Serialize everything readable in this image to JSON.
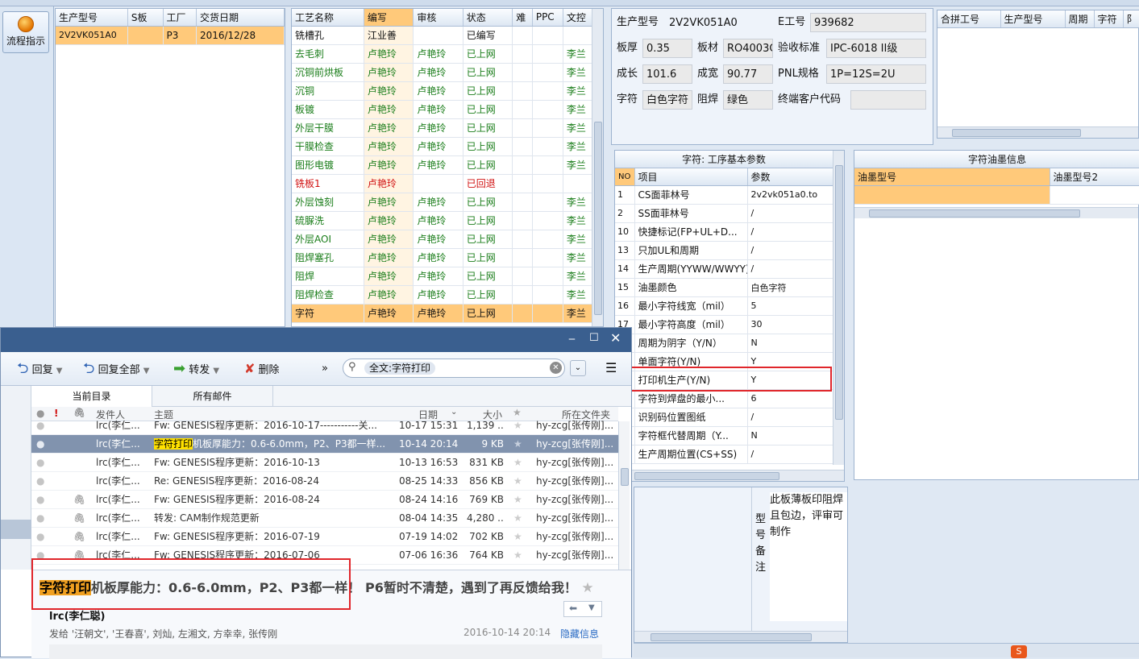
{
  "left_toolbar": {
    "flow_button": "流程指示"
  },
  "product_grid": {
    "headers": [
      "生产型号",
      "S板",
      "工厂",
      "交货日期"
    ],
    "rows": [
      [
        "2V2VK051A0",
        "",
        "P3",
        "2016/12/28"
      ]
    ]
  },
  "process_grid": {
    "headers": [
      "工艺名称",
      "编写",
      "审核",
      "状态",
      "难",
      "PPC",
      "文控"
    ],
    "rows": [
      {
        "name": "铣槽孔",
        "writer": "江业善",
        "reviewer": "",
        "status": "已编写",
        "doc": "",
        "style": "normal"
      },
      {
        "name": "去毛刺",
        "writer": "卢艳玲",
        "reviewer": "卢艳玲",
        "status": "已上网",
        "doc": "李兰",
        "style": "green"
      },
      {
        "name": "沉铜前烘板",
        "writer": "卢艳玲",
        "reviewer": "卢艳玲",
        "status": "已上网",
        "doc": "李兰",
        "style": "green"
      },
      {
        "name": "沉铜",
        "writer": "卢艳玲",
        "reviewer": "卢艳玲",
        "status": "已上网",
        "doc": "李兰",
        "style": "green"
      },
      {
        "name": "板镀",
        "writer": "卢艳玲",
        "reviewer": "卢艳玲",
        "status": "已上网",
        "doc": "李兰",
        "style": "green"
      },
      {
        "name": "外层干膜",
        "writer": "卢艳玲",
        "reviewer": "卢艳玲",
        "status": "已上网",
        "doc": "李兰",
        "style": "green"
      },
      {
        "name": "干膜检查",
        "writer": "卢艳玲",
        "reviewer": "卢艳玲",
        "status": "已上网",
        "doc": "李兰",
        "style": "green"
      },
      {
        "name": "图形电镀",
        "writer": "卢艳玲",
        "reviewer": "卢艳玲",
        "status": "已上网",
        "doc": "李兰",
        "style": "green"
      },
      {
        "name": "铣板1",
        "writer": "卢艳玲",
        "reviewer": "",
        "status": "已回退",
        "doc": "",
        "style": "red"
      },
      {
        "name": "外层蚀刻",
        "writer": "卢艳玲",
        "reviewer": "卢艳玲",
        "status": "已上网",
        "doc": "李兰",
        "style": "green"
      },
      {
        "name": "硫脲洗",
        "writer": "卢艳玲",
        "reviewer": "卢艳玲",
        "status": "已上网",
        "doc": "李兰",
        "style": "green"
      },
      {
        "name": "外层AOI",
        "writer": "卢艳玲",
        "reviewer": "卢艳玲",
        "status": "已上网",
        "doc": "李兰",
        "style": "green"
      },
      {
        "name": "阻焊塞孔",
        "writer": "卢艳玲",
        "reviewer": "卢艳玲",
        "status": "已上网",
        "doc": "李兰",
        "style": "green"
      },
      {
        "name": "阻焊",
        "writer": "卢艳玲",
        "reviewer": "卢艳玲",
        "status": "已上网",
        "doc": "李兰",
        "style": "green"
      },
      {
        "name": "阻焊检查",
        "writer": "卢艳玲",
        "reviewer": "卢艳玲",
        "status": "已上网",
        "doc": "李兰",
        "style": "green"
      },
      {
        "name": "字符",
        "writer": "卢艳玲",
        "reviewer": "卢艳玲",
        "status": "已上网",
        "doc": "李兰",
        "style": "selected"
      }
    ]
  },
  "info": {
    "part_no_label": "生产型号",
    "part_no": "2V2VK051A0",
    "e_no_label": "E工号",
    "e_no": "939682",
    "thickness_label": "板厚",
    "thickness": "0.35",
    "material_label": "板材",
    "material": "RO4003C",
    "standard_label": "验收标准",
    "standard": "IPC-6018 II级",
    "length_label": "成长",
    "length": "101.6",
    "width_label": "成宽",
    "width": "90.77",
    "pnl_label": "PNL规格",
    "pnl": "1P=12S=2U",
    "char_label": "字符",
    "char": "白色字符",
    "mask_label": "阻焊",
    "mask": "绿色",
    "customer_label": "终端客户代码",
    "customer": ""
  },
  "merge_grid": {
    "headers": [
      "合拼工号",
      "生产型号",
      "周期",
      "字符",
      "阝"
    ]
  },
  "param_grid": {
    "title": "字符: 工序基本参数",
    "headers": [
      "NO",
      "项目",
      "参数"
    ],
    "rows": [
      [
        "1",
        "CS面菲林号",
        "2v2vk051a0.to"
      ],
      [
        "2",
        "SS面菲林号",
        "/"
      ],
      [
        "10",
        "快捷标记(FP+UL+D...",
        "/"
      ],
      [
        "13",
        "只加UL和周期",
        "/"
      ],
      [
        "14",
        "生产周期(YYWW/WWYY)",
        "/"
      ],
      [
        "15",
        "油墨颜色",
        "白色字符"
      ],
      [
        "16",
        "最小字符线宽（mil）",
        "5"
      ],
      [
        "17",
        "最小字符高度（mil）",
        "30"
      ],
      [
        "",
        "周期为阴字（Y/N）",
        "N"
      ],
      [
        "",
        "单面字符(Y/N)",
        "Y"
      ],
      [
        "",
        "打印机生产(Y/N)",
        "Y"
      ],
      [
        "",
        "字符到焊盘的最小...",
        "6"
      ],
      [
        "",
        "识别码位置图纸",
        "/"
      ],
      [
        "",
        "字符框代替周期（Y...",
        "N"
      ],
      [
        "",
        "生产周期位置(CS+SS)",
        "/"
      ]
    ]
  },
  "ink_grid": {
    "title": "字符油墨信息",
    "headers": [
      "油墨型号",
      "油墨型号2"
    ]
  },
  "note": {
    "label_chars": [
      "型",
      "号",
      "备",
      "注"
    ],
    "text": "此板薄板印阻焊且包边，评审可制作"
  },
  "mail": {
    "toolbar": {
      "reply": "回复",
      "reply_all": "回复全部",
      "forward": "转发",
      "delete": "删除",
      "more": "»"
    },
    "search": "全文:字符打印",
    "tabs": [
      "当前目录",
      "所有邮件"
    ],
    "columns": {
      "sender": "发件人",
      "subject": "主题",
      "date": "日期",
      "size": "大小",
      "folder": "所在文件夹"
    },
    "rows": [
      {
        "sender": "lrc(李仁...",
        "subject": "Fw: GENESIS程序更新：2016-10-17-----------关...",
        "subject_hl": "",
        "date": "10-17 15:31",
        "size": "1,139 ...",
        "folder": "hy-zcg[张传刚]...",
        "attach": false,
        "selected": false
      },
      {
        "sender": "lrc(李仁...",
        "subject": "机板厚能力：0.6-6.0mm，P2、P3都一样...",
        "subject_hl": "字符打印",
        "date": "10-14 20:14",
        "size": "9 KB",
        "folder": "hy-zcg[张传刚]...",
        "attach": false,
        "selected": true
      },
      {
        "sender": "lrc(李仁...",
        "subject": "Fw: GENESIS程序更新：2016-10-13",
        "subject_hl": "",
        "date": "10-13 16:53",
        "size": "831 KB",
        "folder": "hy-zcg[张传刚]...",
        "attach": false,
        "selected": false
      },
      {
        "sender": "lrc(李仁...",
        "subject": "Re: GENESIS程序更新：2016-08-24",
        "subject_hl": "",
        "date": "08-25 14:33",
        "size": "856 KB",
        "folder": "hy-zcg[张传刚]...",
        "attach": false,
        "selected": false
      },
      {
        "sender": "lrc(李仁...",
        "subject": "Fw: GENESIS程序更新：2016-08-24",
        "subject_hl": "",
        "date": "08-24 14:16",
        "size": "769 KB",
        "folder": "hy-zcg[张传刚]...",
        "attach": true,
        "selected": false
      },
      {
        "sender": "lrc(李仁...",
        "subject": "转发: CAM制作规范更新",
        "subject_hl": "",
        "date": "08-04 14:35",
        "size": "4,280 ...",
        "folder": "hy-zcg[张传刚]...",
        "attach": true,
        "selected": false
      },
      {
        "sender": "lrc(李仁...",
        "subject": "Fw: GENESIS程序更新：2016-07-19",
        "subject_hl": "",
        "date": "07-19 14:02",
        "size": "702 KB",
        "folder": "hy-zcg[张传刚]...",
        "attach": true,
        "selected": false
      },
      {
        "sender": "lrc(李仁...",
        "subject": "Fw: GENESIS程序更新：2016-07-06",
        "subject_hl": "",
        "date": "07-06 16:36",
        "size": "764 KB",
        "folder": "hy-zcg[张传刚]...",
        "attach": true,
        "selected": false
      }
    ],
    "preview": {
      "subject_hl": "字符打印",
      "subject_rest": "机板厚能力：0.6-6.0mm，P2、P3都一样！ P6暂时不清楚，遇到了再反馈给我！",
      "from": "lrc(李仁聪)",
      "to": "发给 '汪朝文', '王春喜', 刘灿, 左湘文, 方幸幸, 张传刚",
      "time": "2016-10-14 20:14",
      "hide": "隐藏信息"
    }
  },
  "colors": {
    "selected_row": "#ffc97a",
    "highlight": "#ffe100",
    "mail_selected": "#8193ae",
    "red_box": "#e0262b",
    "green_text": "#1a7d1a",
    "red_text": "#d01010"
  }
}
